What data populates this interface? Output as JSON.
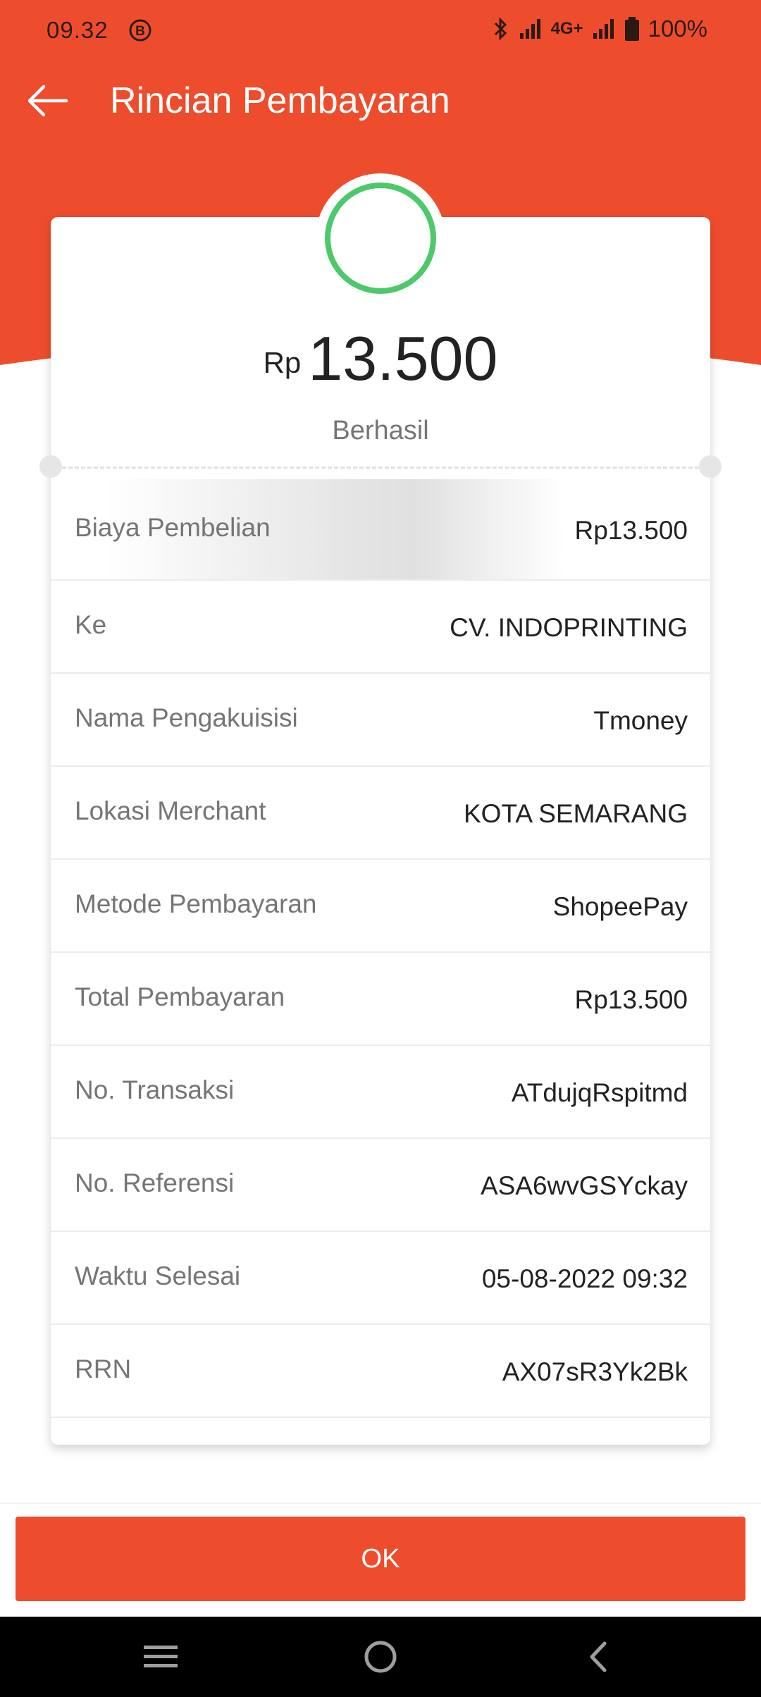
{
  "status_bar": {
    "time": "09.32",
    "network": "4G+",
    "battery": "100%"
  },
  "appbar": {
    "title": "Rincian Pembayaran",
    "back_icon": "arrow-left-icon"
  },
  "summary": {
    "currency": "Rp",
    "amount": "13.500",
    "status": "Berhasil",
    "status_color": "#4cc96a"
  },
  "details": [
    {
      "label": "Biaya Pembelian",
      "value": "Rp13.500"
    },
    {
      "label": "Ke",
      "value": "CV. INDOPRINTING"
    },
    {
      "label": "Nama Pengakuisisi",
      "value": "Tmoney"
    },
    {
      "label": "Lokasi Merchant",
      "value": "KOTA SEMARANG"
    },
    {
      "label": "Metode Pembayaran",
      "value": "ShopeePay"
    },
    {
      "label": "Total Pembayaran",
      "value": "Rp13.500"
    },
    {
      "label": "No. Transaksi",
      "value": "ATdujqRspitmd"
    },
    {
      "label": "No. Referensi",
      "value": "ASA6wvGSYckay"
    },
    {
      "label": "Waktu Selesai",
      "value": "05-08-2022 09:32"
    },
    {
      "label": "RRN",
      "value": "AX07sR3Yk2Bk"
    }
  ],
  "actions": {
    "ok_label": "OK"
  },
  "colors": {
    "brand": "#ee4d2d",
    "success": "#4cc96a"
  }
}
